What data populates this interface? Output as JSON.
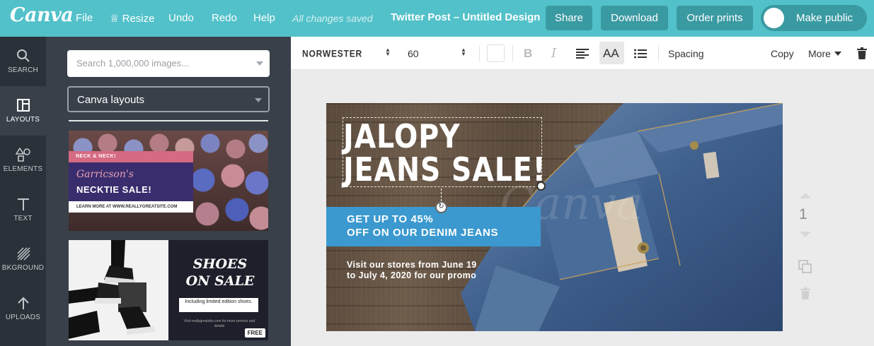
{
  "app": {
    "logo": "Canva",
    "menu": [
      "File",
      "Resize",
      "Undo",
      "Redo",
      "Help"
    ],
    "saved_status": "All changes saved",
    "document_title": "Twitter Post – Untitled Design",
    "buttons": {
      "share": "Share",
      "download": "Download",
      "order_prints": "Order prints",
      "make_public": "Make public"
    },
    "accent_color": "#52c1c9"
  },
  "rail": {
    "items": [
      {
        "label": "SEARCH",
        "icon": "search-icon"
      },
      {
        "label": "LAYOUTS",
        "icon": "layouts-icon"
      },
      {
        "label": "ELEMENTS",
        "icon": "elements-icon"
      },
      {
        "label": "TEXT",
        "icon": "text-icon"
      },
      {
        "label": "BKGROUND",
        "icon": "background-icon"
      },
      {
        "label": "UPLOADS",
        "icon": "uploads-icon"
      }
    ]
  },
  "panel": {
    "search_placeholder": "Search 1,000,000 images...",
    "dropdown_value": "Canva layouts",
    "templates": [
      {
        "tag": "NECK & NECK!",
        "script": "Garricson's",
        "headline": "NECKTIE SALE!",
        "url": "LEARN MORE AT WWW.REALLYGREATSITE.COM"
      },
      {
        "headline": "SHOES ON SALE",
        "badge": "Including limited edition shoes.",
        "small": "Visit reallygreatsite.com for more promos and details",
        "free": "FREE"
      }
    ]
  },
  "toolbar": {
    "font": "NORWESTER",
    "size": "60",
    "bold": "B",
    "italic": "I",
    "case": "AA",
    "spacing": "Spacing",
    "copy": "Copy",
    "more": "More"
  },
  "design": {
    "headline_line1": "JALOPY",
    "headline_line2": "JEANS SALE!",
    "offer_line1": "GET UP TO 45%",
    "offer_line2": "OFF ON OUR DENIM JEANS",
    "visit_line1": "Visit our stores from June 19",
    "visit_line2": "to July 4, 2020 for our promo",
    "watermark": "Canva",
    "box_color": "#3b99cf"
  },
  "pager": {
    "page": "1"
  }
}
